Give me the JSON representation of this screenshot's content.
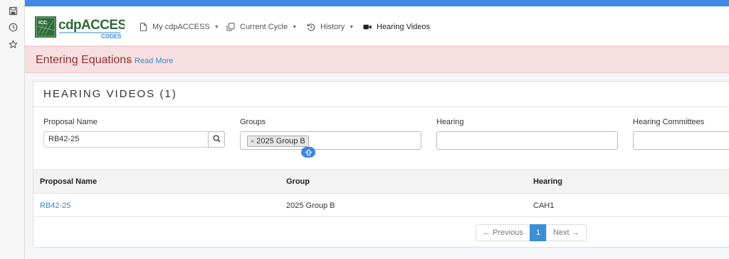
{
  "browser_sidebar": {
    "icons": [
      "save-page-icon",
      "history-clock-icon",
      "star-icon"
    ]
  },
  "navbar": {
    "logo": {
      "brand": "cdpACCESS",
      "sub": "CODES",
      "badge": "ICC"
    },
    "items": [
      {
        "label": "My cdpACCESS",
        "icon": "document-icon",
        "has_caret": true
      },
      {
        "label": "Current Cycle",
        "icon": "copy-icon",
        "has_caret": true
      },
      {
        "label": "History",
        "icon": "history-icon",
        "has_caret": true
      },
      {
        "label": "Hearing Videos",
        "icon": "video-camera-icon",
        "has_caret": false
      }
    ]
  },
  "alert": {
    "title": "Entering Equations",
    "separator": "-",
    "link": "Read More"
  },
  "panel": {
    "title": "HEARING VIDEOS (1)"
  },
  "filters": {
    "proposal_name": {
      "label": "Proposal Name",
      "value": "RB42-25"
    },
    "groups": {
      "label": "Groups",
      "selected_tag": "2025 Group B",
      "remove_glyph": "×"
    },
    "hearing": {
      "label": "Hearing",
      "value": ""
    },
    "hearing_committees": {
      "label": "Hearing Committees",
      "value": ""
    }
  },
  "table": {
    "columns": [
      "Proposal Name",
      "Group",
      "Hearing"
    ],
    "rows": [
      {
        "proposal": "RB42-25",
        "group": "2025 Group B",
        "hearing": "CAH1"
      }
    ]
  },
  "pagination": {
    "previous": "← Previous",
    "current": "1",
    "next": "Next →"
  },
  "colors": {
    "accent": "#3e8ae6",
    "alert_bg": "#f7dfe1",
    "alert_text": "#8e2f33",
    "link": "#3d86c6"
  }
}
